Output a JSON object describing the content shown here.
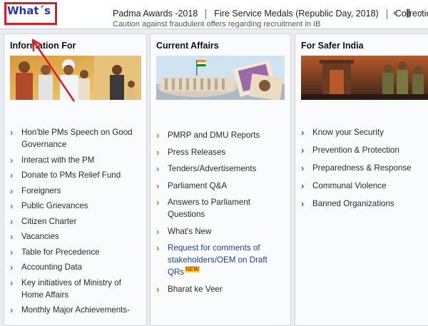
{
  "ticker": {
    "whats_label": "What´s",
    "items": [
      "Padma Awards -2018",
      "Fire Service Medals (Republic Day, 2018)",
      "Correctio"
    ],
    "subline": "Caution against fraudulent offers regarding recruitment in IB",
    "prev_icon": "‹",
    "pause_icon": "||",
    "next_icon": "›"
  },
  "panels": {
    "info": {
      "title": "Information For",
      "items": [
        "Hon'ble PMs Speech on Good Governance",
        "Interact with the PM",
        "Donate to PMs Relief Fund",
        "Foreigners",
        "Public Grievances",
        "Citizen Charter",
        "Vacancies",
        "Table for Precedence",
        "Accounting Data",
        "Key initiatives of Ministry of Home Affairs",
        "Monthly Major Achievements-"
      ]
    },
    "current": {
      "title": "Current Affairs",
      "items": [
        "PMRP and DMU Reports",
        "Press Releases",
        "Tenders/Advertisements",
        "Parliament Q&A",
        "Answers to Parliament Questions",
        "What's New",
        "Request for comments of stakeholders/OEM on Draft QRs",
        "Bharat ke Veer"
      ],
      "new_badge": "NEW"
    },
    "safer": {
      "title": "For Safer India",
      "items": [
        "Know your Security",
        "Prevention & Protection",
        "Preparedness & Response",
        "Communal Violence",
        "Banned Organizations"
      ]
    }
  },
  "colors": {
    "annotation_red": "#d91f26",
    "whats_blue": "#2a35b8",
    "link_blue": "#1d3fa8"
  }
}
